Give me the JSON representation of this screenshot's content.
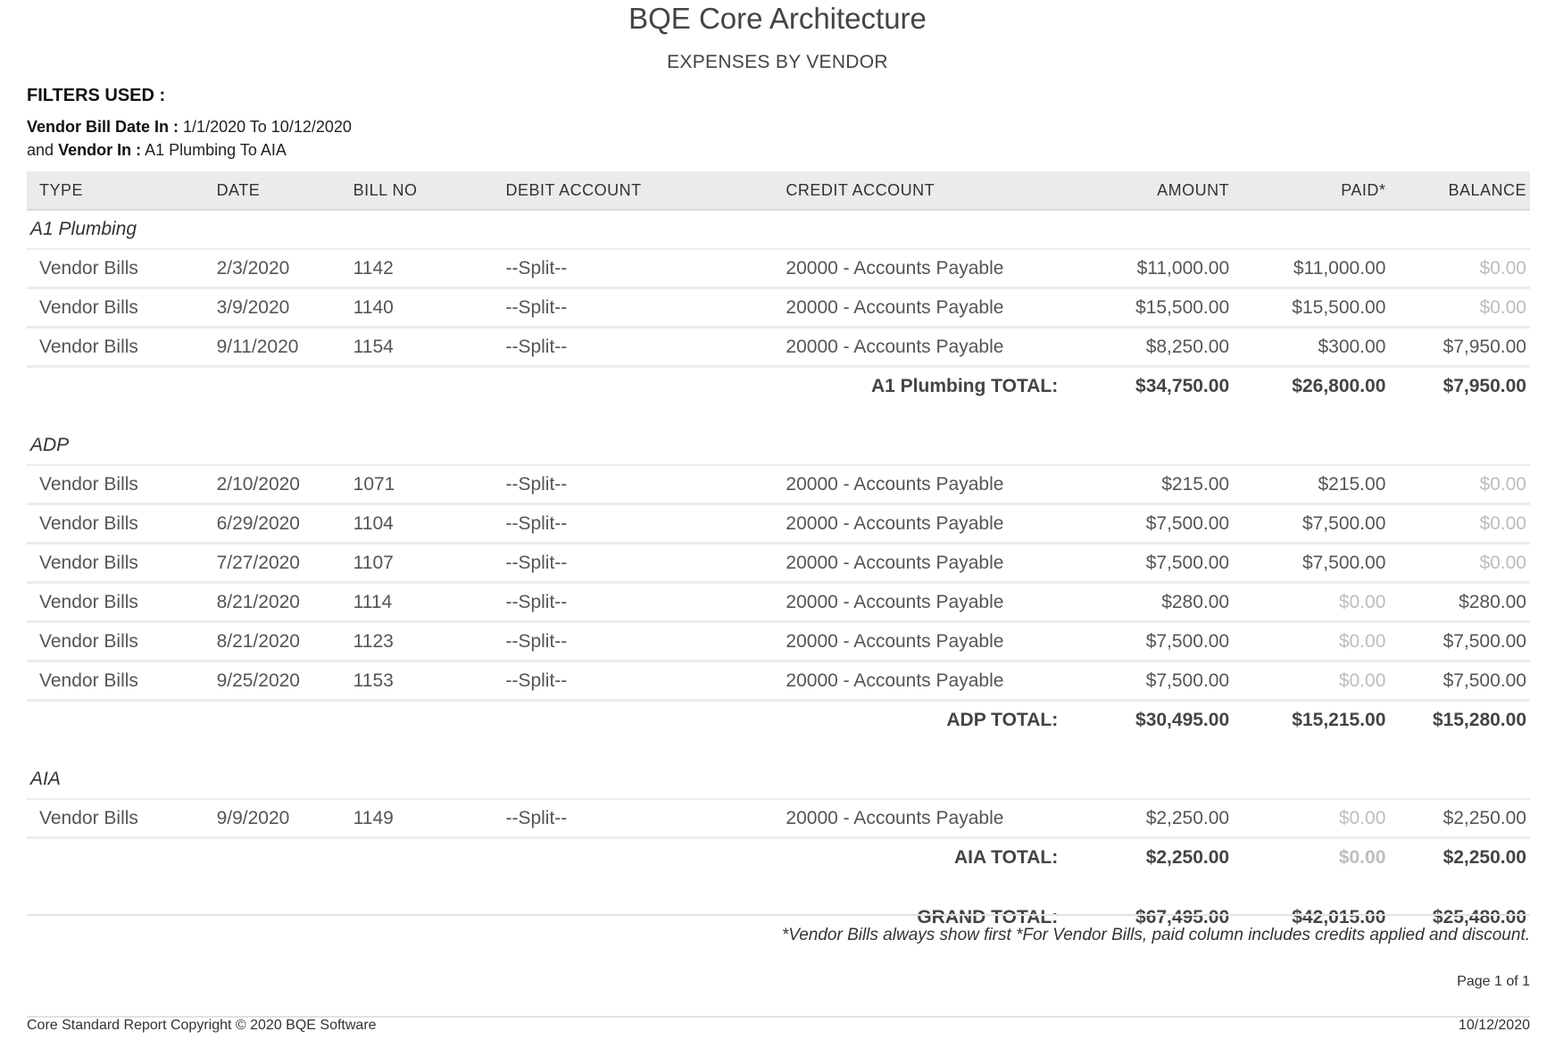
{
  "report": {
    "company": "BQE Core Architecture",
    "title": "EXPENSES BY VENDOR"
  },
  "filters": {
    "heading": "FILTERS USED :",
    "line1_label": "Vendor Bill Date In :",
    "line1_value": "1/1/2020 To 10/12/2020",
    "line2_prefix": "and",
    "line2_label": "Vendor In :",
    "line2_value": "A1 Plumbing To AIA"
  },
  "columns": [
    "TYPE",
    "DATE",
    "BILL NO",
    "DEBIT ACCOUNT",
    "CREDIT ACCOUNT",
    "AMOUNT",
    "PAID*",
    "BALANCE"
  ],
  "groups": [
    {
      "vendor": "A1 Plumbing",
      "rows": [
        [
          "Vendor Bills",
          "2/3/2020",
          "1142",
          "--Split--",
          "20000 - Accounts Payable",
          "$11,000.00",
          "$11,000.00",
          "$0.00"
        ],
        [
          "Vendor Bills",
          "3/9/2020",
          "1140",
          "--Split--",
          "20000 - Accounts Payable",
          "$15,500.00",
          "$15,500.00",
          "$0.00"
        ],
        [
          "Vendor Bills",
          "9/11/2020",
          "1154",
          "--Split--",
          "20000 - Accounts Payable",
          "$8,250.00",
          "$300.00",
          "$7,950.00"
        ]
      ],
      "total_label": "A1 Plumbing TOTAL:",
      "total": [
        "$34,750.00",
        "$26,800.00",
        "$7,950.00"
      ]
    },
    {
      "vendor": "ADP",
      "rows": [
        [
          "Vendor Bills",
          "2/10/2020",
          "1071",
          "--Split--",
          "20000 - Accounts Payable",
          "$215.00",
          "$215.00",
          "$0.00"
        ],
        [
          "Vendor Bills",
          "6/29/2020",
          "1104",
          "--Split--",
          "20000 - Accounts Payable",
          "$7,500.00",
          "$7,500.00",
          "$0.00"
        ],
        [
          "Vendor Bills",
          "7/27/2020",
          "1107",
          "--Split--",
          "20000 - Accounts Payable",
          "$7,500.00",
          "$7,500.00",
          "$0.00"
        ],
        [
          "Vendor Bills",
          "8/21/2020",
          "1114",
          "--Split--",
          "20000 - Accounts Payable",
          "$280.00",
          "$0.00",
          "$280.00"
        ],
        [
          "Vendor Bills",
          "8/21/2020",
          "1123",
          "--Split--",
          "20000 - Accounts Payable",
          "$7,500.00",
          "$0.00",
          "$7,500.00"
        ],
        [
          "Vendor Bills",
          "9/25/2020",
          "1153",
          "--Split--",
          "20000 - Accounts Payable",
          "$7,500.00",
          "$0.00",
          "$7,500.00"
        ]
      ],
      "total_label": "ADP TOTAL:",
      "total": [
        "$30,495.00",
        "$15,215.00",
        "$15,280.00"
      ]
    },
    {
      "vendor": "AIA",
      "rows": [
        [
          "Vendor Bills",
          "9/9/2020",
          "1149",
          "--Split--",
          "20000 - Accounts Payable",
          "$2,250.00",
          "$0.00",
          "$2,250.00"
        ]
      ],
      "total_label": "AIA TOTAL:",
      "total": [
        "$2,250.00",
        "$0.00",
        "$2,250.00"
      ]
    }
  ],
  "grand_total": {
    "label": "GRAND TOTAL:",
    "values": [
      "$67,495.00",
      "$42,015.00",
      "$25,480.00"
    ]
  },
  "footer": {
    "note": "*Vendor Bills always show first *For Vendor Bills, paid column includes credits applied and discount.",
    "page": "Page 1 of 1",
    "copyright": "Core Standard Report Copyright © 2020 BQE Software",
    "date": "10/12/2020"
  },
  "colors": {
    "header_bg": "#ebebeb",
    "zero_value": "#bdbdbd",
    "text": "#555555"
  }
}
